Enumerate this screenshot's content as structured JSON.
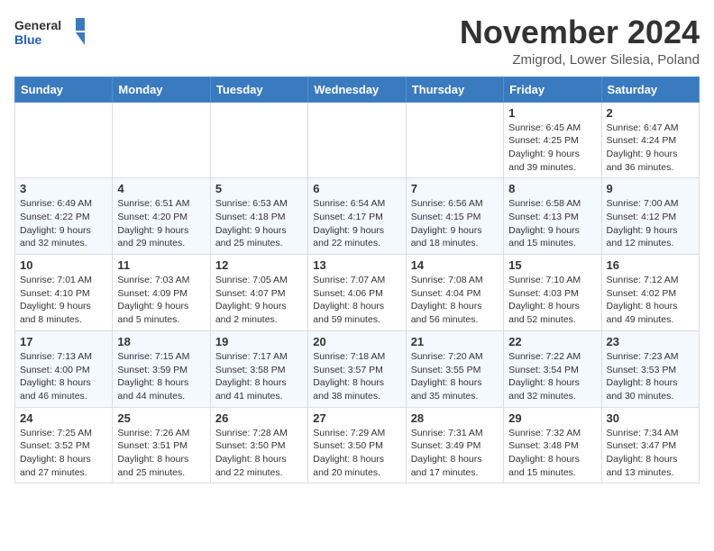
{
  "header": {
    "logo_general": "General",
    "logo_blue": "Blue",
    "month_title": "November 2024",
    "location": "Zmigrod, Lower Silesia, Poland"
  },
  "days_of_week": [
    "Sunday",
    "Monday",
    "Tuesday",
    "Wednesday",
    "Thursday",
    "Friday",
    "Saturday"
  ],
  "weeks": [
    [
      {
        "day": "",
        "info": ""
      },
      {
        "day": "",
        "info": ""
      },
      {
        "day": "",
        "info": ""
      },
      {
        "day": "",
        "info": ""
      },
      {
        "day": "",
        "info": ""
      },
      {
        "day": "1",
        "info": "Sunrise: 6:45 AM\nSunset: 4:25 PM\nDaylight: 9 hours\nand 39 minutes."
      },
      {
        "day": "2",
        "info": "Sunrise: 6:47 AM\nSunset: 4:24 PM\nDaylight: 9 hours\nand 36 minutes."
      }
    ],
    [
      {
        "day": "3",
        "info": "Sunrise: 6:49 AM\nSunset: 4:22 PM\nDaylight: 9 hours\nand 32 minutes."
      },
      {
        "day": "4",
        "info": "Sunrise: 6:51 AM\nSunset: 4:20 PM\nDaylight: 9 hours\nand 29 minutes."
      },
      {
        "day": "5",
        "info": "Sunrise: 6:53 AM\nSunset: 4:18 PM\nDaylight: 9 hours\nand 25 minutes."
      },
      {
        "day": "6",
        "info": "Sunrise: 6:54 AM\nSunset: 4:17 PM\nDaylight: 9 hours\nand 22 minutes."
      },
      {
        "day": "7",
        "info": "Sunrise: 6:56 AM\nSunset: 4:15 PM\nDaylight: 9 hours\nand 18 minutes."
      },
      {
        "day": "8",
        "info": "Sunrise: 6:58 AM\nSunset: 4:13 PM\nDaylight: 9 hours\nand 15 minutes."
      },
      {
        "day": "9",
        "info": "Sunrise: 7:00 AM\nSunset: 4:12 PM\nDaylight: 9 hours\nand 12 minutes."
      }
    ],
    [
      {
        "day": "10",
        "info": "Sunrise: 7:01 AM\nSunset: 4:10 PM\nDaylight: 9 hours\nand 8 minutes."
      },
      {
        "day": "11",
        "info": "Sunrise: 7:03 AM\nSunset: 4:09 PM\nDaylight: 9 hours\nand 5 minutes."
      },
      {
        "day": "12",
        "info": "Sunrise: 7:05 AM\nSunset: 4:07 PM\nDaylight: 9 hours\nand 2 minutes."
      },
      {
        "day": "13",
        "info": "Sunrise: 7:07 AM\nSunset: 4:06 PM\nDaylight: 8 hours\nand 59 minutes."
      },
      {
        "day": "14",
        "info": "Sunrise: 7:08 AM\nSunset: 4:04 PM\nDaylight: 8 hours\nand 56 minutes."
      },
      {
        "day": "15",
        "info": "Sunrise: 7:10 AM\nSunset: 4:03 PM\nDaylight: 8 hours\nand 52 minutes."
      },
      {
        "day": "16",
        "info": "Sunrise: 7:12 AM\nSunset: 4:02 PM\nDaylight: 8 hours\nand 49 minutes."
      }
    ],
    [
      {
        "day": "17",
        "info": "Sunrise: 7:13 AM\nSunset: 4:00 PM\nDaylight: 8 hours\nand 46 minutes."
      },
      {
        "day": "18",
        "info": "Sunrise: 7:15 AM\nSunset: 3:59 PM\nDaylight: 8 hours\nand 44 minutes."
      },
      {
        "day": "19",
        "info": "Sunrise: 7:17 AM\nSunset: 3:58 PM\nDaylight: 8 hours\nand 41 minutes."
      },
      {
        "day": "20",
        "info": "Sunrise: 7:18 AM\nSunset: 3:57 PM\nDaylight: 8 hours\nand 38 minutes."
      },
      {
        "day": "21",
        "info": "Sunrise: 7:20 AM\nSunset: 3:55 PM\nDaylight: 8 hours\nand 35 minutes."
      },
      {
        "day": "22",
        "info": "Sunrise: 7:22 AM\nSunset: 3:54 PM\nDaylight: 8 hours\nand 32 minutes."
      },
      {
        "day": "23",
        "info": "Sunrise: 7:23 AM\nSunset: 3:53 PM\nDaylight: 8 hours\nand 30 minutes."
      }
    ],
    [
      {
        "day": "24",
        "info": "Sunrise: 7:25 AM\nSunset: 3:52 PM\nDaylight: 8 hours\nand 27 minutes."
      },
      {
        "day": "25",
        "info": "Sunrise: 7:26 AM\nSunset: 3:51 PM\nDaylight: 8 hours\nand 25 minutes."
      },
      {
        "day": "26",
        "info": "Sunrise: 7:28 AM\nSunset: 3:50 PM\nDaylight: 8 hours\nand 22 minutes."
      },
      {
        "day": "27",
        "info": "Sunrise: 7:29 AM\nSunset: 3:50 PM\nDaylight: 8 hours\nand 20 minutes."
      },
      {
        "day": "28",
        "info": "Sunrise: 7:31 AM\nSunset: 3:49 PM\nDaylight: 8 hours\nand 17 minutes."
      },
      {
        "day": "29",
        "info": "Sunrise: 7:32 AM\nSunset: 3:48 PM\nDaylight: 8 hours\nand 15 minutes."
      },
      {
        "day": "30",
        "info": "Sunrise: 7:34 AM\nSunset: 3:47 PM\nDaylight: 8 hours\nand 13 minutes."
      }
    ]
  ]
}
